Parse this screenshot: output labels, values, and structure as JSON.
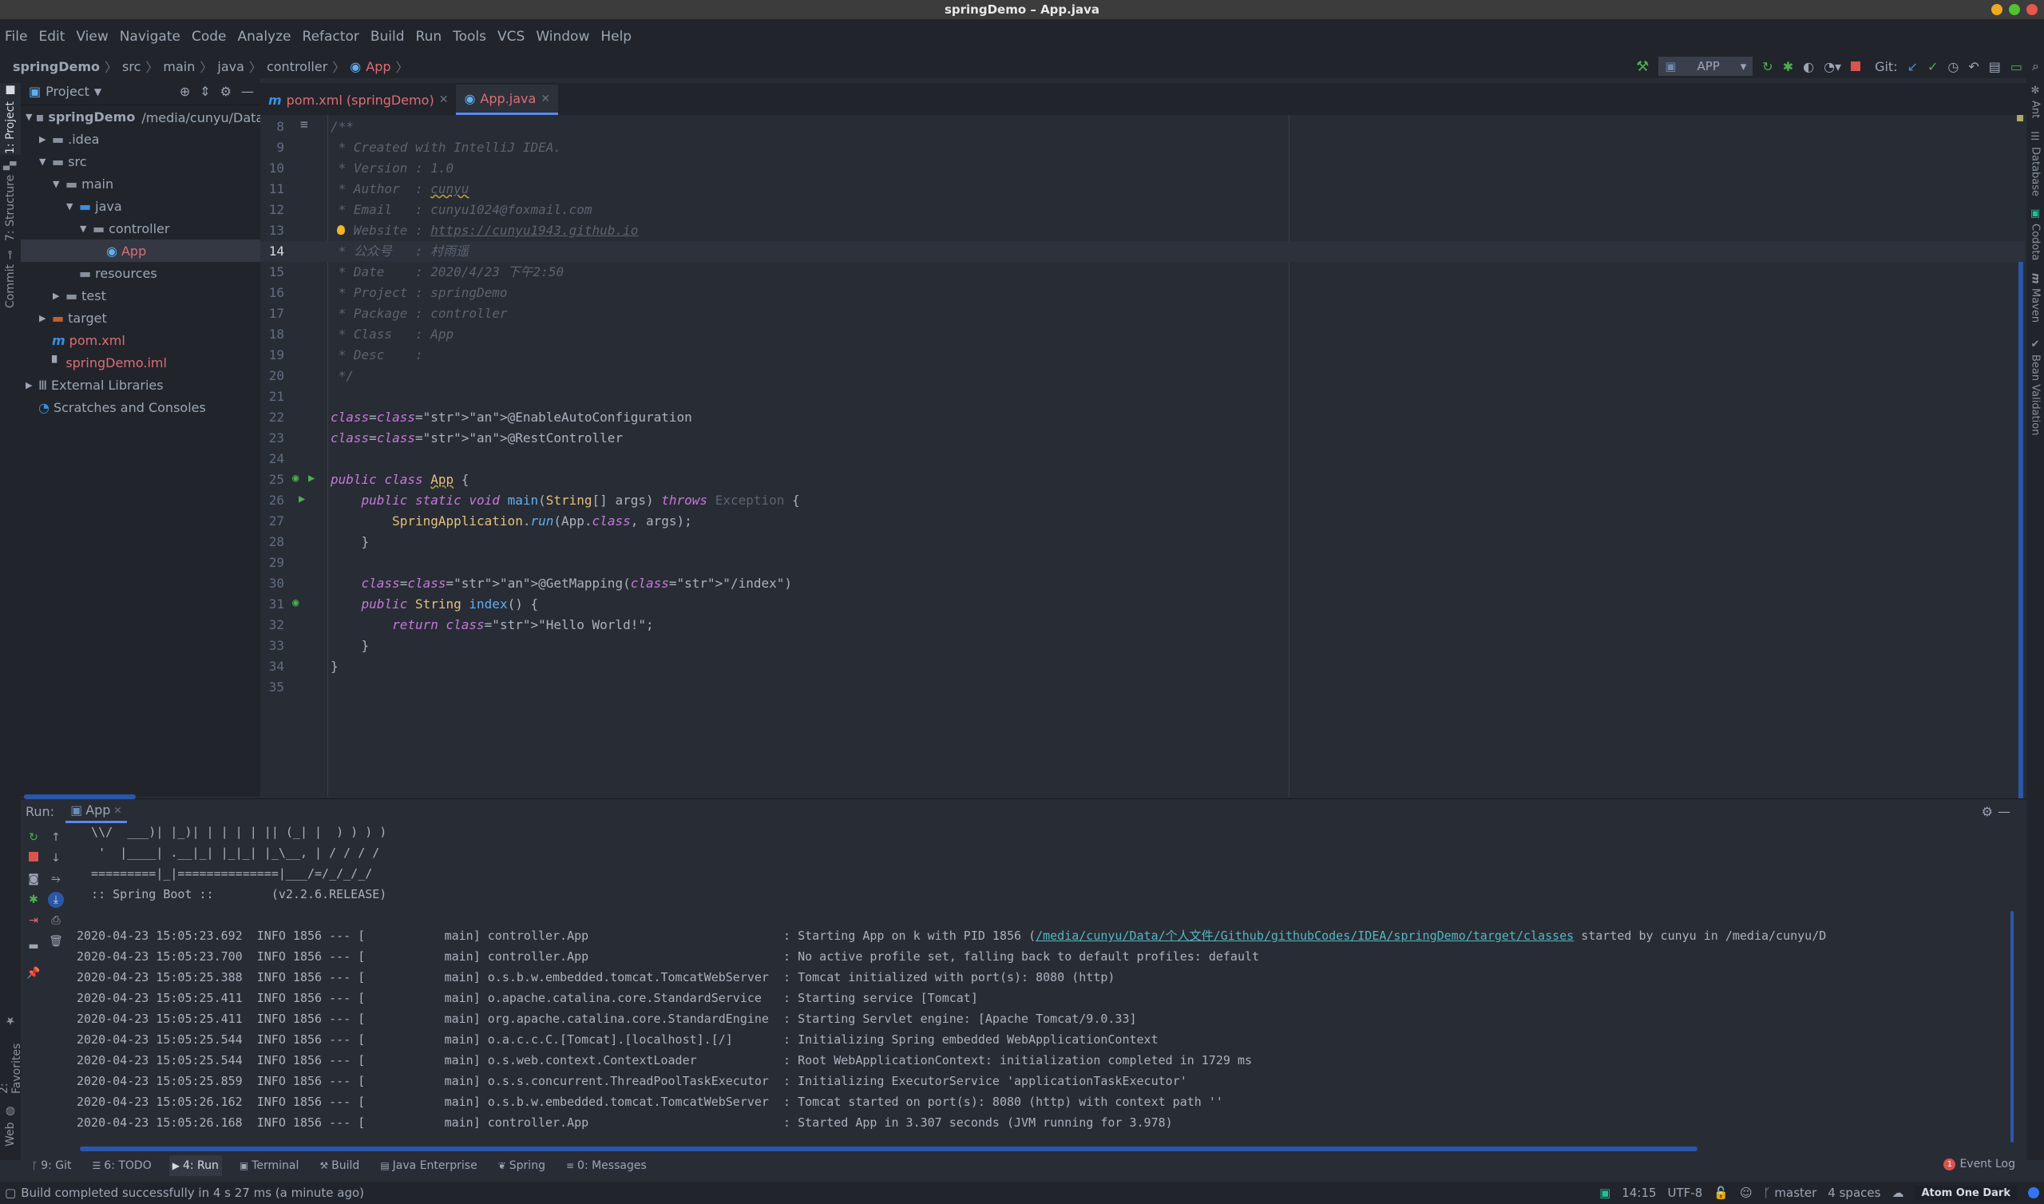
{
  "window": {
    "title": "springDemo – App.java",
    "controls": {
      "minimize_color": "#f0a823",
      "maximize_color": "#4fc42f",
      "close_color": "#e8564c"
    }
  },
  "menu": [
    "File",
    "Edit",
    "View",
    "Navigate",
    "Code",
    "Analyze",
    "Refactor",
    "Build",
    "Run",
    "Tools",
    "VCS",
    "Window",
    "Help"
  ],
  "breadcrumb": [
    "springDemo",
    "src",
    "main",
    "java",
    "controller",
    "App"
  ],
  "toolbar": {
    "run_config": "APP",
    "git_label": "Git:",
    "icons": [
      "build-hammer-icon",
      "rerun-icon",
      "debug-icon",
      "coverage-icon",
      "profile-icon",
      "stop-icon",
      "git-update-icon",
      "git-commit-icon",
      "git-history-icon",
      "git-rollback-icon",
      "project-structure-icon",
      "terminal-icon",
      "search-icon"
    ]
  },
  "left_strip": {
    "tabs": [
      "1: Project",
      "7: Structure",
      "Commit",
      "2: Favorites",
      "Web"
    ]
  },
  "right_strip": {
    "tabs": [
      "Ant",
      "Database",
      "Codota",
      "Maven",
      "Bean Validation"
    ]
  },
  "project": {
    "title": "Project",
    "tree": [
      {
        "label": "springDemo",
        "extra": "/media/cunyu/Data/个人",
        "level": 0,
        "expanded": true,
        "bold": true,
        "type": "module"
      },
      {
        "label": ".idea",
        "level": 1,
        "expanded": false,
        "type": "folder"
      },
      {
        "label": "src",
        "level": 1,
        "expanded": true,
        "type": "folder"
      },
      {
        "label": "main",
        "level": 2,
        "expanded": true,
        "type": "folder"
      },
      {
        "label": "java",
        "level": 3,
        "expanded": true,
        "type": "source-folder"
      },
      {
        "label": "controller",
        "level": 4,
        "expanded": true,
        "type": "package"
      },
      {
        "label": "App",
        "level": 5,
        "type": "spring-class",
        "selected": true,
        "color": "red"
      },
      {
        "label": "resources",
        "level": 3,
        "type": "resources-folder"
      },
      {
        "label": "test",
        "level": 2,
        "expanded": false,
        "type": "folder"
      },
      {
        "label": "target",
        "level": 1,
        "expanded": false,
        "type": "excluded-folder"
      },
      {
        "label": "pom.xml",
        "level": 1,
        "type": "maven-file",
        "color": "red"
      },
      {
        "label": "springDemo.iml",
        "level": 1,
        "type": "iml-file",
        "color": "red"
      },
      {
        "label": "External Libraries",
        "level": 0,
        "expanded": false,
        "type": "libraries"
      },
      {
        "label": "Scratches and Consoles",
        "level": 0,
        "type": "scratches"
      }
    ]
  },
  "editor_tabs": [
    {
      "label": "pom.xml (springDemo)",
      "icon": "maven-icon",
      "active": false
    },
    {
      "label": "App.java",
      "icon": "spring-class-icon",
      "active": true
    }
  ],
  "editor": {
    "current_line": 14,
    "lines": [
      {
        "n": 8,
        "t": "/**"
      },
      {
        "n": 9,
        "t": " * Created with IntelliJ IDEA."
      },
      {
        "n": 10,
        "t": " * Version : 1.0"
      },
      {
        "n": 11,
        "t": " * Author  : cunyu"
      },
      {
        "n": 12,
        "t": " * Email   : cunyu1024@foxmail.com"
      },
      {
        "n": 13,
        "t": " * Website : https://cunyu1943.github.io"
      },
      {
        "n": 14,
        "t": " * 公众号   : 村雨遥"
      },
      {
        "n": 15,
        "t": " * Date    : 2020/4/23 下午2:50"
      },
      {
        "n": 16,
        "t": " * Project : springDemo"
      },
      {
        "n": 17,
        "t": " * Package : controller"
      },
      {
        "n": 18,
        "t": " * Class   : App"
      },
      {
        "n": 19,
        "t": " * Desc    :"
      },
      {
        "n": 20,
        "t": " */"
      },
      {
        "n": 21,
        "t": ""
      },
      {
        "n": 22,
        "t": "@EnableAutoConfiguration"
      },
      {
        "n": 23,
        "t": "@RestController"
      },
      {
        "n": 24,
        "t": ""
      },
      {
        "n": 25,
        "t": "public class App {"
      },
      {
        "n": 26,
        "t": "    public static void main(String[] args) throws Exception {"
      },
      {
        "n": 27,
        "t": "        SpringApplication.run(App.class, args);"
      },
      {
        "n": 28,
        "t": "    }"
      },
      {
        "n": 29,
        "t": ""
      },
      {
        "n": 30,
        "t": "    @GetMapping(\"/index\")"
      },
      {
        "n": 31,
        "t": "    public String index() {"
      },
      {
        "n": 32,
        "t": "        return \"Hello World!\";"
      },
      {
        "n": 33,
        "t": "    }"
      },
      {
        "n": 34,
        "t": "}"
      },
      {
        "n": 35,
        "t": ""
      }
    ]
  },
  "run": {
    "label": "Run:",
    "tab": "App",
    "banner": [
      "  \\\\/  ___)| |_)| | | | | || (_| |  ) ) ) )",
      "   '  |____| .__|_| |_|_| |_\\__, | / / / /",
      "  =========|_|==============|___/=/_/_/_/",
      "  :: Spring Boot ::        (v2.2.6.RELEASE)"
    ],
    "logs": [
      {
        "ts": "2020-04-23 15:05:23.692",
        "level": "INFO",
        "pid": "1856",
        "thread": "main",
        "logger": "controller.App",
        "msg_pre": "Starting App on k with PID 1856 (",
        "link": "/media/cunyu/Data/个人文件/Github/githubCodes/IDEA/springDemo/target/classes",
        "msg_post": " started by cunyu in /media/cunyu/D"
      },
      {
        "ts": "2020-04-23 15:05:23.700",
        "level": "INFO",
        "pid": "1856",
        "thread": "main",
        "logger": "controller.App",
        "msg_pre": "No active profile set, falling back to default profiles: default"
      },
      {
        "ts": "2020-04-23 15:05:25.388",
        "level": "INFO",
        "pid": "1856",
        "thread": "main",
        "logger": "o.s.b.w.embedded.tomcat.TomcatWebServer",
        "msg_pre": "Tomcat initialized with port(s): 8080 (http)"
      },
      {
        "ts": "2020-04-23 15:05:25.411",
        "level": "INFO",
        "pid": "1856",
        "thread": "main",
        "logger": "o.apache.catalina.core.StandardService",
        "msg_pre": "Starting service [Tomcat]"
      },
      {
        "ts": "2020-04-23 15:05:25.411",
        "level": "INFO",
        "pid": "1856",
        "thread": "main",
        "logger": "org.apache.catalina.core.StandardEngine",
        "msg_pre": "Starting Servlet engine: [Apache Tomcat/9.0.33]"
      },
      {
        "ts": "2020-04-23 15:05:25.544",
        "level": "INFO",
        "pid": "1856",
        "thread": "main",
        "logger": "o.a.c.c.C.[Tomcat].[localhost].[/]",
        "msg_pre": "Initializing Spring embedded WebApplicationContext"
      },
      {
        "ts": "2020-04-23 15:05:25.544",
        "level": "INFO",
        "pid": "1856",
        "thread": "main",
        "logger": "o.s.web.context.ContextLoader",
        "msg_pre": "Root WebApplicationContext: initialization completed in 1729 ms"
      },
      {
        "ts": "2020-04-23 15:05:25.859",
        "level": "INFO",
        "pid": "1856",
        "thread": "main",
        "logger": "o.s.s.concurrent.ThreadPoolTaskExecutor",
        "msg_pre": "Initializing ExecutorService 'applicationTaskExecutor'"
      },
      {
        "ts": "2020-04-23 15:05:26.162",
        "level": "INFO",
        "pid": "1856",
        "thread": "main",
        "logger": "o.s.b.w.embedded.tomcat.TomcatWebServer",
        "msg_pre": "Tomcat started on port(s): 8080 (http) with context path ''"
      },
      {
        "ts": "2020-04-23 15:05:26.168",
        "level": "INFO",
        "pid": "1856",
        "thread": "main",
        "logger": "controller.App",
        "msg_pre": "Started App in 3.307 seconds (JVM running for 3.978)"
      }
    ]
  },
  "bottom_tabs": [
    {
      "label": "9: Git",
      "icon": "git-branch-icon"
    },
    {
      "label": "6: TODO",
      "icon": "todo-list-icon"
    },
    {
      "label": "4: Run",
      "icon": "run-icon",
      "active": true
    },
    {
      "label": "Terminal",
      "icon": "terminal-icon"
    },
    {
      "label": "Build",
      "icon": "build-hammer-icon"
    },
    {
      "label": "Java Enterprise",
      "icon": "java-enterprise-icon"
    },
    {
      "label": "Spring",
      "icon": "spring-leaf-icon"
    },
    {
      "label": "0: Messages",
      "icon": "messages-icon"
    }
  ],
  "event_log": {
    "label": "Event Log",
    "count": "1"
  },
  "status": {
    "message": "Build completed successfully in 4 s 27 ms (a minute ago)",
    "position": "14:15",
    "encoding": "UTF-8",
    "branch": "master",
    "indent": "4 spaces",
    "theme": "Atom One Dark"
  }
}
